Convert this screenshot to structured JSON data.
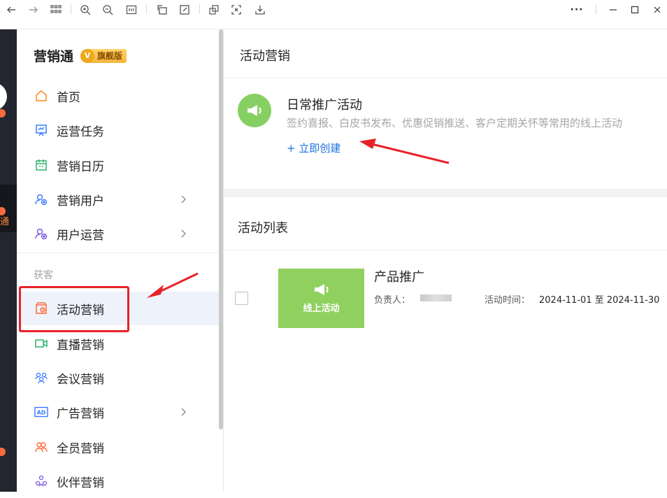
{
  "toolbar": {
    "more_glyph": "···",
    "icons": [
      "back-arrow-icon",
      "forward-arrow-icon",
      "grid-icon",
      "zoom-in-icon",
      "zoom-out-icon",
      "fit-screen-icon",
      "rotate-icon",
      "edit-icon",
      "copy-icon",
      "crop-icon",
      "download-icon"
    ],
    "window": [
      "minimize-icon",
      "maximize-icon",
      "close-icon"
    ]
  },
  "darkbar": {
    "label": "通"
  },
  "sidebar": {
    "brand": "营销通",
    "badge": "旗舰版",
    "badge_v": "V",
    "items": [
      {
        "label": "首页",
        "icon": "home-icon"
      },
      {
        "label": "运营任务",
        "icon": "task-icon"
      },
      {
        "label": "营销日历",
        "icon": "calendar-icon"
      },
      {
        "label": "营销用户",
        "icon": "users-icon",
        "chevron": true
      },
      {
        "label": "用户运营",
        "icon": "user-ops-icon",
        "chevron": true
      }
    ],
    "section": "获客",
    "items2": [
      {
        "label": "活动营销",
        "icon": "event-icon",
        "active": true
      },
      {
        "label": "直播营销",
        "icon": "live-icon"
      },
      {
        "label": "会议营销",
        "icon": "meeting-icon"
      },
      {
        "label": "广告营销",
        "icon": "ad-icon",
        "chevron": true
      },
      {
        "label": "全员营销",
        "icon": "staff-icon"
      },
      {
        "label": "伙伴营销",
        "icon": "partner-icon"
      }
    ]
  },
  "main": {
    "title": "活动营销",
    "daily": {
      "title": "日常推广活动",
      "desc": "签约喜报、白皮书发布、优惠促销推送、客户定期关怀等常用的线上活动",
      "create": "+ 立即创建"
    },
    "list_title": "活动列表",
    "card": {
      "thumb_label": "线上活动",
      "title": "产品推广",
      "owner_label": "负责人：",
      "time_label": "活动时间：",
      "time_value": "2024-11-01 至 2024-11-30"
    }
  },
  "colors": {
    "accent_link": "#1a6fe0",
    "active_bg": "#eef2fb",
    "green": "#86d063",
    "annotation_red": "#e8222a"
  }
}
